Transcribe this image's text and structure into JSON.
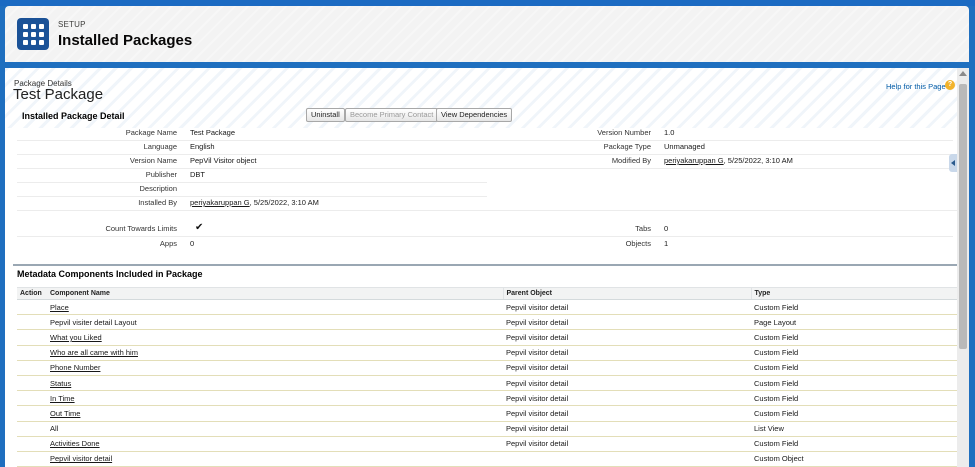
{
  "header": {
    "setup_label": "SETUP",
    "title": "Installed Packages"
  },
  "page": {
    "breadcrumb": "Package Details",
    "title": "Test Package",
    "help_link": "Help for this Page",
    "help_icon": "question-icon"
  },
  "detail": {
    "section_title": "Installed Package Detail",
    "buttons": {
      "uninstall": "Uninstall",
      "become_primary": "Become Primary Contact",
      "view_dependencies": "View Dependencies"
    },
    "fields": {
      "package_name": {
        "label": "Package Name",
        "value": "Test Package"
      },
      "language": {
        "label": "Language",
        "value": "English"
      },
      "version_name": {
        "label": "Version Name",
        "value": "PepVil Visitor object"
      },
      "publisher": {
        "label": "Publisher",
        "value": "DBT"
      },
      "description": {
        "label": "Description",
        "value": ""
      },
      "installed_by": {
        "label": "Installed By",
        "user": "periyakaruppan G",
        "date": ", 5/25/2022, 3:10 AM"
      },
      "version_number": {
        "label": "Version Number",
        "value": "1.0"
      },
      "package_type": {
        "label": "Package Type",
        "value": "Unmanaged"
      },
      "modified_by": {
        "label": "Modified By",
        "user": "periyakaruppan G",
        "date": ", 5/25/2022, 3:10 AM"
      },
      "count_limits": {
        "label": "Count Towards Limits",
        "value": "✔"
      },
      "apps": {
        "label": "Apps",
        "value": "0"
      },
      "tabs": {
        "label": "Tabs",
        "value": "0"
      },
      "objects": {
        "label": "Objects",
        "value": "1"
      }
    }
  },
  "metadata": {
    "title": "Metadata Components Included in Package",
    "columns": [
      "Action",
      "Component Name",
      "Parent Object",
      "Type"
    ],
    "rows": [
      {
        "name": "Place",
        "link": true,
        "parent": "Pepvil visitor detail",
        "type": "Custom Field"
      },
      {
        "name": "Pepvil visiter detail Layout",
        "link": false,
        "parent": "Pepvil visitor detail",
        "type": "Page Layout"
      },
      {
        "name": "What you Liked",
        "link": true,
        "parent": "Pepvil visitor detail",
        "type": "Custom Field"
      },
      {
        "name": "Who are all came with him",
        "link": true,
        "parent": "Pepvil visitor detail",
        "type": "Custom Field"
      },
      {
        "name": "Phone Number",
        "link": true,
        "parent": "Pepvil visitor detail",
        "type": "Custom Field"
      },
      {
        "name": "Status",
        "link": true,
        "parent": "Pepvil visitor detail",
        "type": "Custom Field"
      },
      {
        "name": "In Time",
        "link": true,
        "parent": "Pepvil visitor detail",
        "type": "Custom Field"
      },
      {
        "name": "Out Time",
        "link": true,
        "parent": "Pepvil visitor detail",
        "type": "Custom Field"
      },
      {
        "name": "All",
        "link": false,
        "parent": "Pepvil visitor detail",
        "type": "List View"
      },
      {
        "name": "Activities Done",
        "link": true,
        "parent": "Pepvil visitor detail",
        "type": "Custom Field"
      },
      {
        "name": "Pepvil visitor detail",
        "link": true,
        "parent": "",
        "type": "Custom Object"
      }
    ]
  }
}
